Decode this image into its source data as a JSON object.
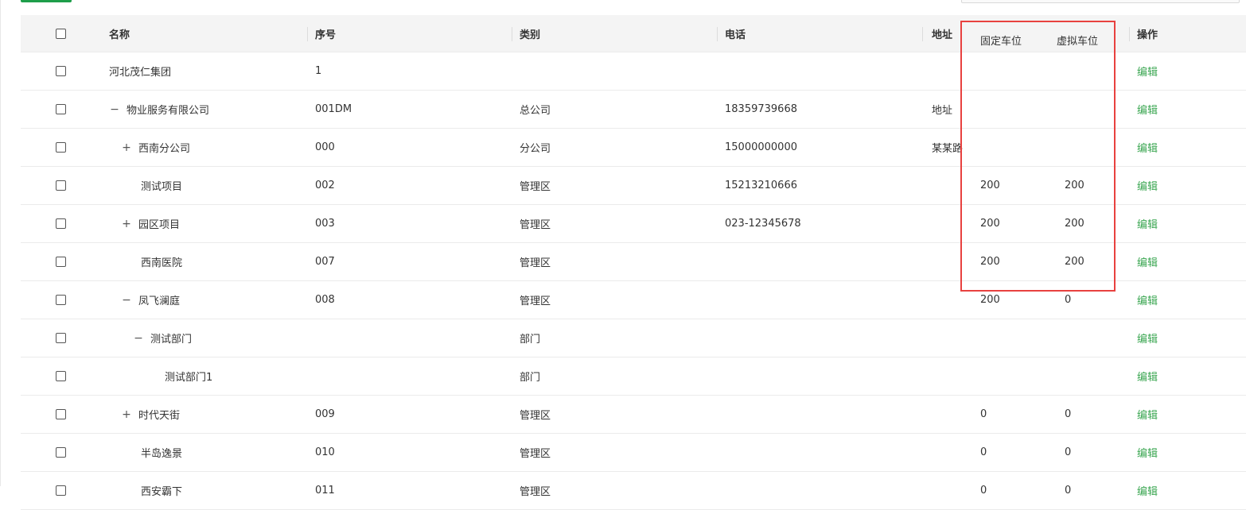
{
  "header": {
    "name": "名称",
    "seq": "序号",
    "category": "类别",
    "phone": "电话",
    "address": "地址",
    "fixed_parking": "固定车位",
    "virtual_parking": "虚拟车位",
    "actions": "操作"
  },
  "rows": [
    {
      "name": "河北茂仁集团",
      "toggle": "",
      "seq": "1",
      "category": "",
      "phone": "",
      "address": "",
      "fixed": "",
      "virtual": "",
      "action": "编辑"
    },
    {
      "name": "物业服务有限公司",
      "toggle": "−",
      "seq": "001DM",
      "category": "总公司",
      "phone": "18359739668",
      "address": "地址",
      "fixed": "",
      "virtual": "",
      "action": "编辑"
    },
    {
      "name": "西南分公司",
      "toggle": "+",
      "seq": "000",
      "category": "分公司",
      "phone": "15000000000",
      "address": "某某路",
      "fixed": "",
      "virtual": "",
      "action": "编辑"
    },
    {
      "name": "测试项目",
      "toggle": "",
      "seq": "002",
      "category": "管理区",
      "phone": "15213210666",
      "address": "",
      "fixed": "200",
      "virtual": "200",
      "action": "编辑"
    },
    {
      "name": "园区项目",
      "toggle": "+",
      "seq": "003",
      "category": "管理区",
      "phone": "023-12345678",
      "address": "",
      "fixed": "200",
      "virtual": "200",
      "action": "编辑"
    },
    {
      "name": "西南医院",
      "toggle": "",
      "seq": "007",
      "category": "管理区",
      "phone": "",
      "address": "",
      "fixed": "200",
      "virtual": "200",
      "action": "编辑"
    },
    {
      "name": "凤飞澜庭",
      "toggle": "−",
      "seq": "008",
      "category": "管理区",
      "phone": "",
      "address": "",
      "fixed": "200",
      "virtual": "0",
      "action": "编辑"
    },
    {
      "name": "测试部门",
      "toggle": "−",
      "seq": "",
      "category": "部门",
      "phone": "",
      "address": "",
      "fixed": "",
      "virtual": "",
      "action": "编辑"
    },
    {
      "name": "测试部门1",
      "toggle": "",
      "seq": "",
      "category": "部门",
      "phone": "",
      "address": "",
      "fixed": "",
      "virtual": "",
      "action": "编辑"
    },
    {
      "name": "时代天街",
      "toggle": "+",
      "seq": "009",
      "category": "管理区",
      "phone": "",
      "address": "",
      "fixed": "0",
      "virtual": "0",
      "action": "编辑"
    },
    {
      "name": "半岛逸景",
      "toggle": "",
      "seq": "010",
      "category": "管理区",
      "phone": "",
      "address": "",
      "fixed": "0",
      "virtual": "0",
      "action": "编辑"
    },
    {
      "name": "西安霸下",
      "toggle": "",
      "seq": "011",
      "category": "管理区",
      "phone": "",
      "address": "",
      "fixed": "0",
      "virtual": "0",
      "action": "编辑"
    }
  ]
}
